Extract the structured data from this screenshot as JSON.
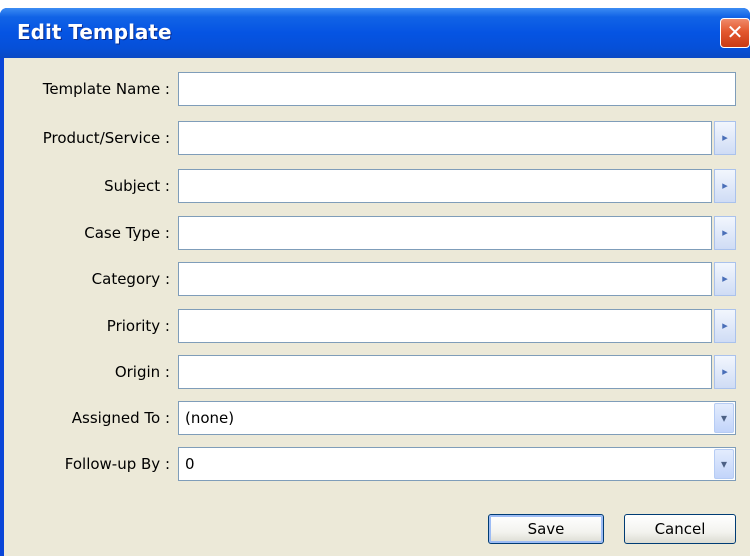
{
  "window": {
    "title": "Edit Template",
    "close_glyph": "✕"
  },
  "form": {
    "template_name": {
      "label": "Template Name :",
      "value": ""
    },
    "product_service": {
      "label": "Product/Service :",
      "value": ""
    },
    "subject": {
      "label": "Subject :",
      "value": ""
    },
    "case_type": {
      "label": "Case Type :",
      "value": ""
    },
    "category": {
      "label": "Category :",
      "value": ""
    },
    "priority": {
      "label": "Priority :",
      "value": ""
    },
    "origin": {
      "label": "Origin :",
      "value": ""
    },
    "assigned_to": {
      "label": "Assigned To :",
      "value": "(none)"
    },
    "follow_up_by": {
      "label": "Follow-up By :",
      "value": "0"
    }
  },
  "buttons": {
    "save": "Save",
    "cancel": "Cancel"
  },
  "icons": {
    "lookup": "▸",
    "dropdown": "▾"
  }
}
